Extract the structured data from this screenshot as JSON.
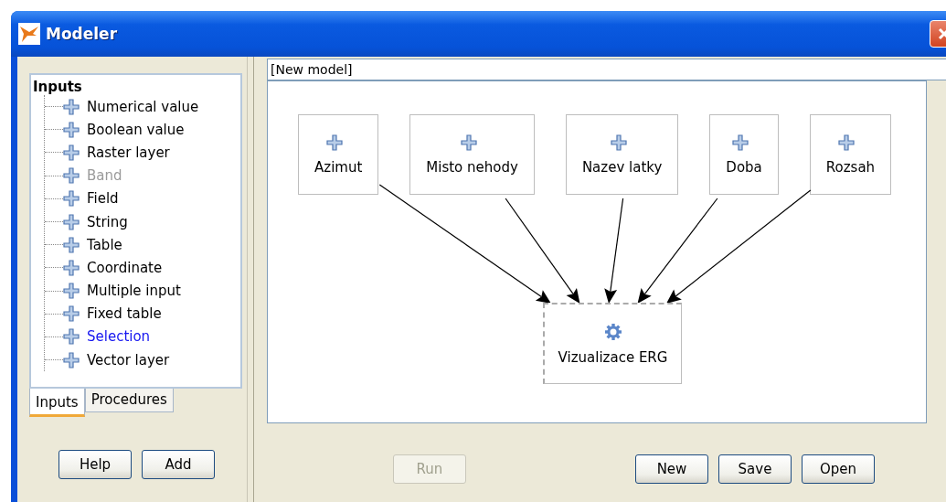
{
  "window": {
    "title": "Modeler"
  },
  "tree": {
    "root": "Inputs",
    "items": [
      {
        "label": "Numerical value",
        "disabled": false,
        "selected": false
      },
      {
        "label": "Boolean value",
        "disabled": false,
        "selected": false
      },
      {
        "label": "Raster layer",
        "disabled": false,
        "selected": false
      },
      {
        "label": "Band",
        "disabled": true,
        "selected": false
      },
      {
        "label": "Field",
        "disabled": false,
        "selected": false
      },
      {
        "label": "String",
        "disabled": false,
        "selected": false
      },
      {
        "label": "Table",
        "disabled": false,
        "selected": false
      },
      {
        "label": "Coordinate",
        "disabled": false,
        "selected": false
      },
      {
        "label": "Multiple input",
        "disabled": false,
        "selected": false
      },
      {
        "label": "Fixed table",
        "disabled": false,
        "selected": false
      },
      {
        "label": "Selection",
        "disabled": false,
        "selected": true
      },
      {
        "label": "Vector layer",
        "disabled": false,
        "selected": false
      }
    ]
  },
  "tabs": [
    {
      "label": "Inputs",
      "selected": true
    },
    {
      "label": "Procedures",
      "selected": false
    }
  ],
  "left_buttons": [
    {
      "label": "Help",
      "disabled": false
    },
    {
      "label": "Add",
      "disabled": false
    }
  ],
  "model_name": {
    "value": "[New model]"
  },
  "model": {
    "inputs": [
      {
        "label": "Azimut"
      },
      {
        "label": "Misto nehody"
      },
      {
        "label": "Nazev latky"
      },
      {
        "label": "Doba"
      },
      {
        "label": "Rozsah"
      }
    ],
    "algorithm": {
      "label": "Vizualizace ERG",
      "selected": true
    }
  },
  "right_buttons": [
    {
      "label": "Run",
      "disabled": true
    },
    {
      "label": "New",
      "disabled": false
    },
    {
      "label": "Save",
      "disabled": false
    },
    {
      "label": "Open",
      "disabled": false
    }
  ]
}
